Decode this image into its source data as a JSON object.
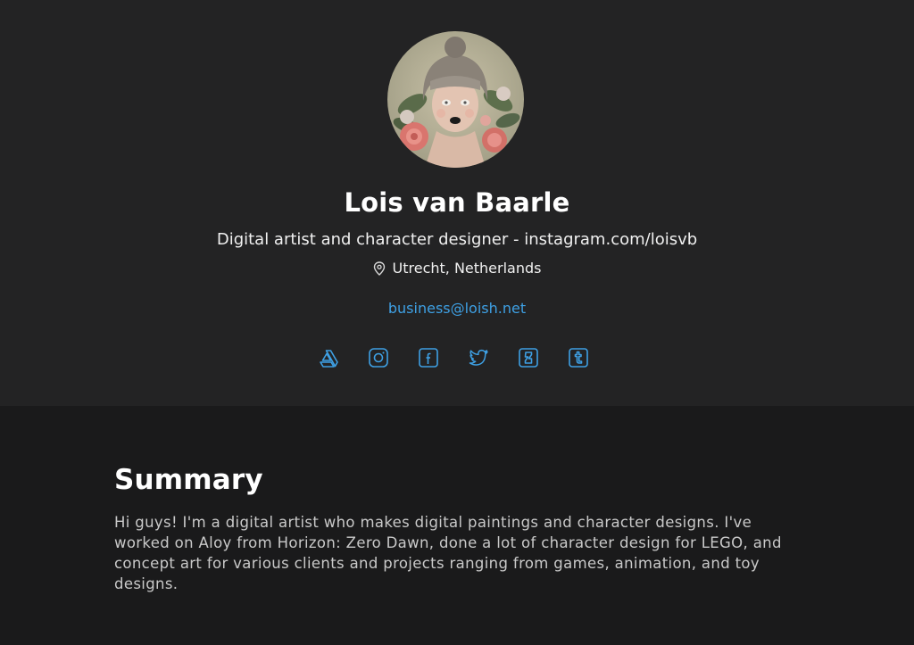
{
  "profile": {
    "name": "Lois van Baarle",
    "headline": "Digital artist and character designer - instagram.com/loisvb",
    "location": "Utrecht, Netherlands",
    "email": "business@loish.net",
    "avatar_icon": "avatar-portrait"
  },
  "socials": [
    {
      "icon": "artstation-icon"
    },
    {
      "icon": "instagram-icon"
    },
    {
      "icon": "facebook-icon"
    },
    {
      "icon": "twitter-icon"
    },
    {
      "icon": "deviantart-icon"
    },
    {
      "icon": "tumblr-icon"
    }
  ],
  "summary": {
    "title": "Summary",
    "text": "Hi guys! I'm a digital artist who makes digital paintings and character designs. I've worked on Aloy from Horizon: Zero Dawn, done a lot of character design for LEGO, and concept art for various clients and projects ranging from games, animation, and toy designs."
  },
  "colors": {
    "accent": "#3ea0e4",
    "header_bg": "#232324",
    "page_bg": "#1a1a1b"
  }
}
